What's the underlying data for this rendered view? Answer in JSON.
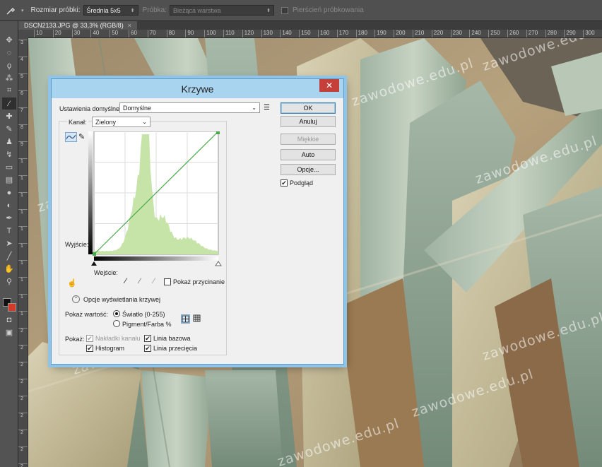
{
  "options_bar": {
    "sample_size_label": "Rozmiar próbki:",
    "sample_size_value": "Średnia 5x5",
    "sample_label": "Próbka:",
    "sample_value": "Bieżąca warstwa",
    "ring_label": "Pierścień próbkowania"
  },
  "document": {
    "tab_title": "DSCN2133.JPG @ 33,3% (RGB/8)",
    "tab_close": "×",
    "ruler_h": [
      "10",
      "20",
      "30",
      "40",
      "50",
      "60",
      "70",
      "80",
      "90",
      "100",
      "110",
      "120",
      "130",
      "140",
      "150",
      "160",
      "170",
      "180",
      "190",
      "200",
      "210",
      "220",
      "230",
      "240",
      "250",
      "260",
      "270",
      "280",
      "290",
      "300"
    ],
    "ruler_v": [
      "3",
      "4",
      "5",
      "6",
      "7",
      "8",
      "9",
      "1",
      "1",
      "1",
      "1",
      "1",
      "1",
      "1",
      "1",
      "1",
      "1",
      "2",
      "2",
      "2",
      "2",
      "2",
      "2",
      "2",
      "2",
      "2"
    ]
  },
  "watermark": "zawodowe.edu.pl",
  "dialog": {
    "title": "Krzywe",
    "close": "✕",
    "preset_label": "Ustawienia domyślne:",
    "preset_value": "Domyślne",
    "buttons": {
      "ok": "OK",
      "cancel": "Anuluj",
      "smooth": "Miękkie",
      "auto": "Auto",
      "options": "Opcje..."
    },
    "preview_label": "Podgląd",
    "channel_label": "Kanał:",
    "channel_value": "Zielony",
    "output_label": "Wyjście:",
    "input_label": "Wejście:",
    "show_clipping": "Pokaż przycinanie",
    "curve_display_options": "Opcje wyświetlania krzywej",
    "show_amount_label": "Pokaż wartość:",
    "light_label": "Światło (0-255)",
    "pigment_label": "Pigment/Farba %",
    "show_label": "Pokaż:",
    "channel_overlays": "Nakładki kanału",
    "baseline": "Linia bazowa",
    "histogram": "Histogram",
    "intersection_line": "Linia przecięcia",
    "check_mark": "✔"
  },
  "colors": {
    "histogram": "#c6e3a8",
    "curve": "#4aa84a",
    "title_bar": "#a9d4f0",
    "close": "#c6403a"
  }
}
